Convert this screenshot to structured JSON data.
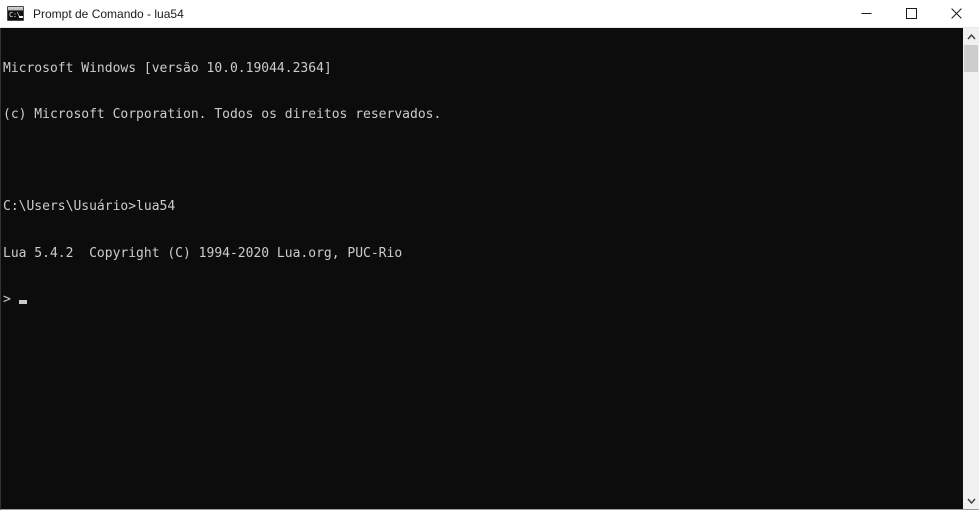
{
  "window": {
    "title": "Prompt de Comando - lua54",
    "icon": "cmd-console-icon",
    "icon_glyph": "C:\\",
    "background_color": "#0c0c0c",
    "titlebar_color": "#ffffff",
    "text_color": "#cccccc"
  },
  "controls": {
    "minimize": "minimize-icon",
    "maximize": "maximize-icon",
    "close": "close-icon"
  },
  "console": {
    "lines": [
      "Microsoft Windows [versão 10.0.19044.2364]",
      "(c) Microsoft Corporation. Todos os direitos reservados.",
      "",
      "C:\\Users\\Usuário>lua54",
      "Lua 5.4.2  Copyright (C) 1994-2020 Lua.org, PUC-Rio"
    ],
    "prompt": "> ",
    "cursor": "block-cursor"
  },
  "scrollbar": {
    "up_arrow": "chevron-up-icon",
    "down_arrow": "chevron-down-icon",
    "thumb": "scrollbar-thumb"
  }
}
